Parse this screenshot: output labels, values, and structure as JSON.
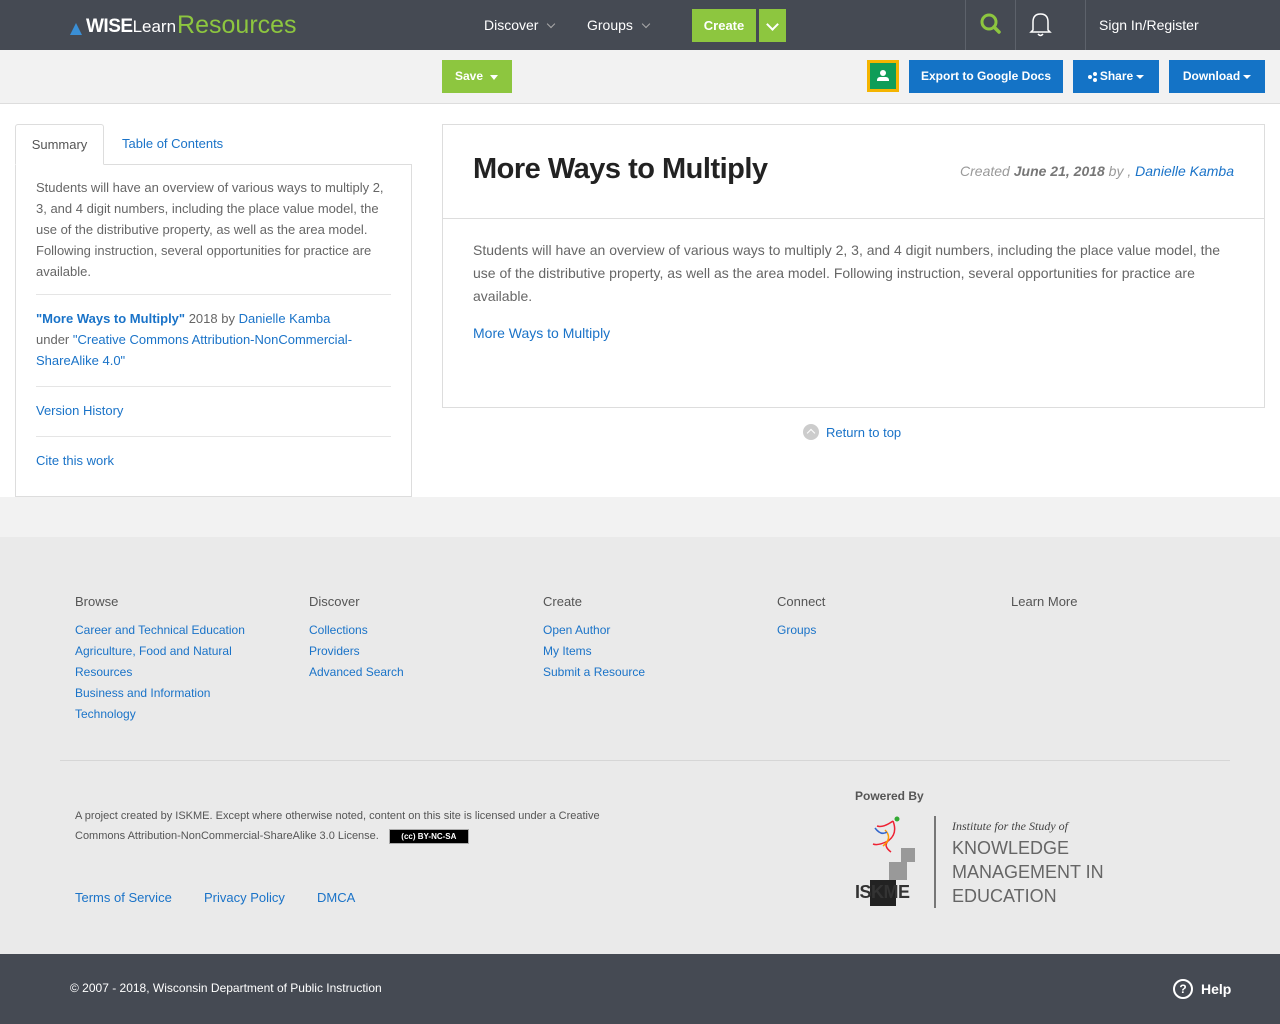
{
  "header": {
    "logo_wise": "WISE",
    "logo_learn": "Learn",
    "logo_resources": "Resources",
    "nav": [
      {
        "label": "Discover"
      },
      {
        "label": "Groups"
      }
    ],
    "create_label": "Create",
    "signin_label": "Sign In/Register"
  },
  "actionbar": {
    "save_label": "Save",
    "export_label": "Export to Google Docs",
    "share_label": "Share",
    "download_label": "Download"
  },
  "left": {
    "tabs": [
      {
        "label": "Summary"
      },
      {
        "label": "Table of Contents"
      }
    ],
    "summary": "Students will have an overview of various ways to multiply 2, 3, and 4 digit numbers, including the place value model, the use of the distributive property, as well as the area model. Following instruction, several opportunities for practice are available.",
    "attribution": {
      "title": "\"More Ways to Multiply\"",
      "year_by": " 2018 by ",
      "author": "Danielle Kamba",
      "under": "under ",
      "license": "\"Creative Commons Attribution-NonCommercial-ShareAlike 4.0\""
    },
    "version_history": "Version History",
    "cite": "Cite this work"
  },
  "main": {
    "title": "More Ways to Multiply",
    "created_label": "Created ",
    "created_date": "June 21, 2018",
    "by": " by , ",
    "author": "Danielle Kamba",
    "description": "Students will have an overview of various ways to multiply 2, 3, and 4 digit numbers, including the place value model, the use of the distributive property, as well as the area model. Following instruction, several opportunities for practice are available.",
    "link": "More Ways to Multiply",
    "return_top": "Return to top"
  },
  "footer": {
    "columns": [
      {
        "heading": "Browse",
        "links": [
          "Career and Technical Education",
          "Agriculture, Food and Natural Resources",
          "Business and Information Technology"
        ]
      },
      {
        "heading": "Discover",
        "links": [
          "Collections",
          "Providers",
          "Advanced Search"
        ]
      },
      {
        "heading": "Create",
        "links": [
          "Open Author",
          "My Items",
          "Submit a Resource"
        ]
      },
      {
        "heading": "Connect",
        "links": [
          "Groups"
        ]
      },
      {
        "heading": "Learn More",
        "links": []
      }
    ],
    "license_text": "A project created by ISKME. Except where otherwise noted, content on this site is licensed under a Creative Commons Attribution-NonCommercial-ShareAlike 3.0 License.",
    "cc_badge": "BY-NC-SA",
    "links": [
      "Terms of Service",
      "Privacy Policy",
      "DMCA"
    ],
    "powered_by": "Powered By",
    "iskme_name": "ISKME",
    "iskme_tagline": "Institute for the Study of",
    "iskme_big": [
      "KNOWLEDGE",
      "MANAGEMENT IN",
      "EDUCATION"
    ],
    "copyright": "© 2007 - 2018, Wisconsin Department of Public Instruction",
    "help": "Help"
  },
  "colors": {
    "nav_bg": "#454a53",
    "accent_green": "#8dc63f",
    "accent_blue": "#1473c6",
    "link": "#1a73c8"
  },
  "icons": [
    "search-icon",
    "bell-icon",
    "google-classroom-icon",
    "share-icon",
    "return-top-icon",
    "help-icon",
    "cc-license-icon"
  ]
}
